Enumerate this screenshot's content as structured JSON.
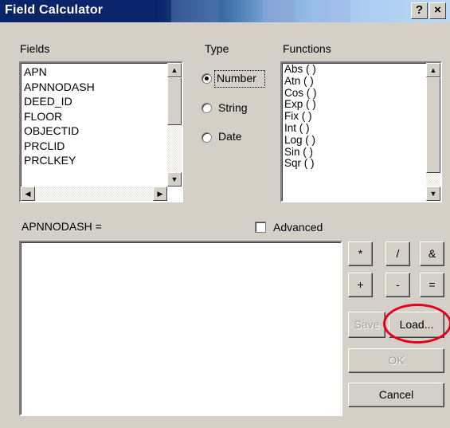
{
  "window": {
    "title": "Field Calculator",
    "help_button": "?",
    "close_button": "×"
  },
  "fields": {
    "label": "Fields",
    "items": [
      "APN",
      "APNNODASH",
      "DEED_ID",
      "FLOOR",
      "OBJECTID",
      "PRCLID",
      "PRCLKEY"
    ]
  },
  "type": {
    "label": "Type",
    "options": [
      "Number",
      "String",
      "Date"
    ],
    "selected": "Number"
  },
  "functions": {
    "label": "Functions",
    "items": [
      "Abs ( )",
      "Atn ( )",
      "Cos ( )",
      "Exp ( )",
      "Fix ( )",
      "Int ( )",
      "Log ( )",
      "Sin ( )",
      "Sqr ( )"
    ]
  },
  "expression": {
    "label": "APNNODASH =",
    "value": ""
  },
  "advanced": {
    "label": "Advanced",
    "checked": false
  },
  "operators": [
    "*",
    "/",
    "&",
    "+",
    "-",
    "="
  ],
  "buttons": {
    "save": "Save",
    "load": "Load...",
    "ok": "OK",
    "cancel": "Cancel"
  },
  "annotation": {
    "color": "#e3001b"
  }
}
